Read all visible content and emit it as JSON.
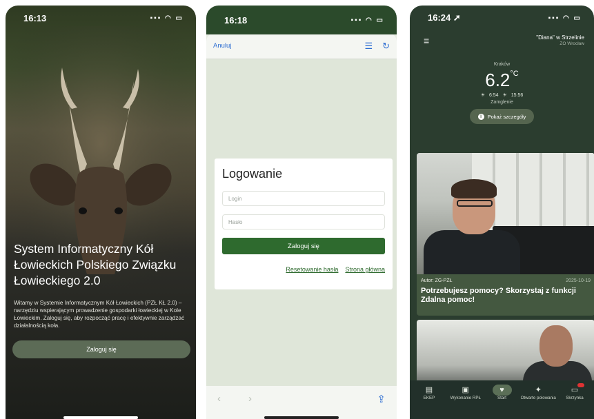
{
  "screen1": {
    "time": "16:13",
    "status_icons": "▪▪▪ ◠ ▭",
    "title": "System Informatyczny Kół Łowieckich Polskiego Związku Łowieckiego 2.0",
    "description": "Witamy w Systemie Informatycznym Kół Łowieckich (PZŁ KŁ 2.0) – narzędziu wspierającym prowadzenie gospodarki łowieckiej w Kole Łowieckim. Zaloguj się, aby rozpocząć pracę i efektywnie zarządzać działalnością koła.",
    "login_button": "Zaloguj się"
  },
  "screen2": {
    "time": "16:18",
    "status_icons": "▪▪▪ ◠ ▭",
    "cancel": "Anuluj",
    "form_title": "Logowanie",
    "login_placeholder": "Login",
    "password_placeholder": "Hasło",
    "submit": "Zaloguj się",
    "reset_link": "Resetowanie hasła",
    "home_link": "Strona główna",
    "back_icon": "‹",
    "forward_icon": "›",
    "share_icon": "⇪"
  },
  "screen3": {
    "time": "16:24 ➚",
    "status_icons": "▪▪▪ ◠ ▭",
    "club_name": "\"Diana\" w Strzelinie",
    "club_sub": "ZO Wrocław",
    "city": "Kraków",
    "temperature": "6.2",
    "unit": "°C",
    "sunrise": "☀ 6:54",
    "sunset": "☀ 15:56",
    "condition": "Zamglenie",
    "details_button": "Pokaż szczegóły",
    "article": {
      "author": "Autor: ZG-PZŁ",
      "date": "2025-10-19",
      "title": "Potrzebujesz pomocy? Skorzystaj z funkcji Zdalna pomoc!"
    },
    "tabs": [
      {
        "label": "EKEP",
        "icon": "▤"
      },
      {
        "label": "Wykonanie RPŁ",
        "icon": "▣"
      },
      {
        "label": "Start",
        "icon": "♥"
      },
      {
        "label": "Otwarte polowania",
        "icon": "✦"
      },
      {
        "label": "Skrzynka",
        "icon": "▭"
      }
    ]
  }
}
